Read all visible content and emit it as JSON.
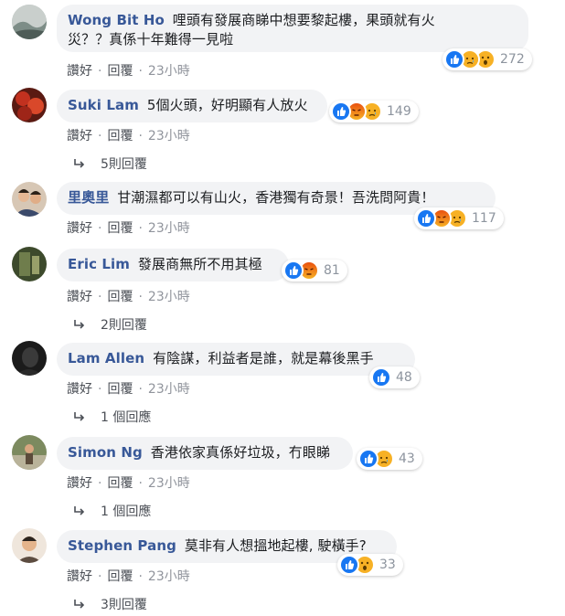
{
  "action_labels": {
    "like": "讚好",
    "reply": "回覆",
    "separator": "·"
  },
  "comments": [
    {
      "author": "Wong Bit Ho",
      "text_line1": "哩頭有發展商睇中想要黎起樓，果頭就有火",
      "text_line2": "災？？真係十年難得一見啦",
      "reactions": [
        "like",
        "sad",
        "wow"
      ],
      "reaction_count": "272",
      "time": "23小時",
      "replies": ""
    },
    {
      "author": "Suki Lam",
      "text": "5個火頭，好明顯有人放火",
      "reactions": [
        "like",
        "angry",
        "sad"
      ],
      "reaction_count": "149",
      "time": "23小時",
      "replies": "5則回覆"
    },
    {
      "author": "里奧里",
      "text": "甘潮濕都可以有山火，香港獨有奇景！吾洗問阿貴！",
      "reactions": [
        "like",
        "angry",
        "sad"
      ],
      "reaction_count": "117",
      "time": "23小時",
      "replies": ""
    },
    {
      "author": "Eric Lim",
      "text": "發展商無所不用其極",
      "reactions": [
        "like",
        "angry"
      ],
      "reaction_count": "81",
      "time": "23小時",
      "replies": "2則回覆"
    },
    {
      "author": "Lam Allen",
      "text": "有陰謀，利益者是誰，就是幕後黑手",
      "reactions": [
        "like"
      ],
      "reaction_count": "48",
      "time": "23小時",
      "replies": "1 個回應"
    },
    {
      "author": "Simon Ng",
      "text": "香港依家真係好垃圾，冇眼睇",
      "reactions": [
        "like",
        "sad"
      ],
      "reaction_count": "43",
      "time": "23小時",
      "replies": "1 個回應"
    },
    {
      "author": "Stephen Pang",
      "text": "莫非有人想搵地起樓, 駛橫手?",
      "reactions": [
        "like",
        "wow"
      ],
      "reaction_count": "33",
      "time": "23小時",
      "replies": "3則回覆"
    }
  ],
  "colors": {
    "like": "#1877f2",
    "angry": "#e9710f",
    "sad": "#f7b125",
    "wow": "#f7b125",
    "name": "#385898",
    "bubble": "#f2f3f5"
  }
}
